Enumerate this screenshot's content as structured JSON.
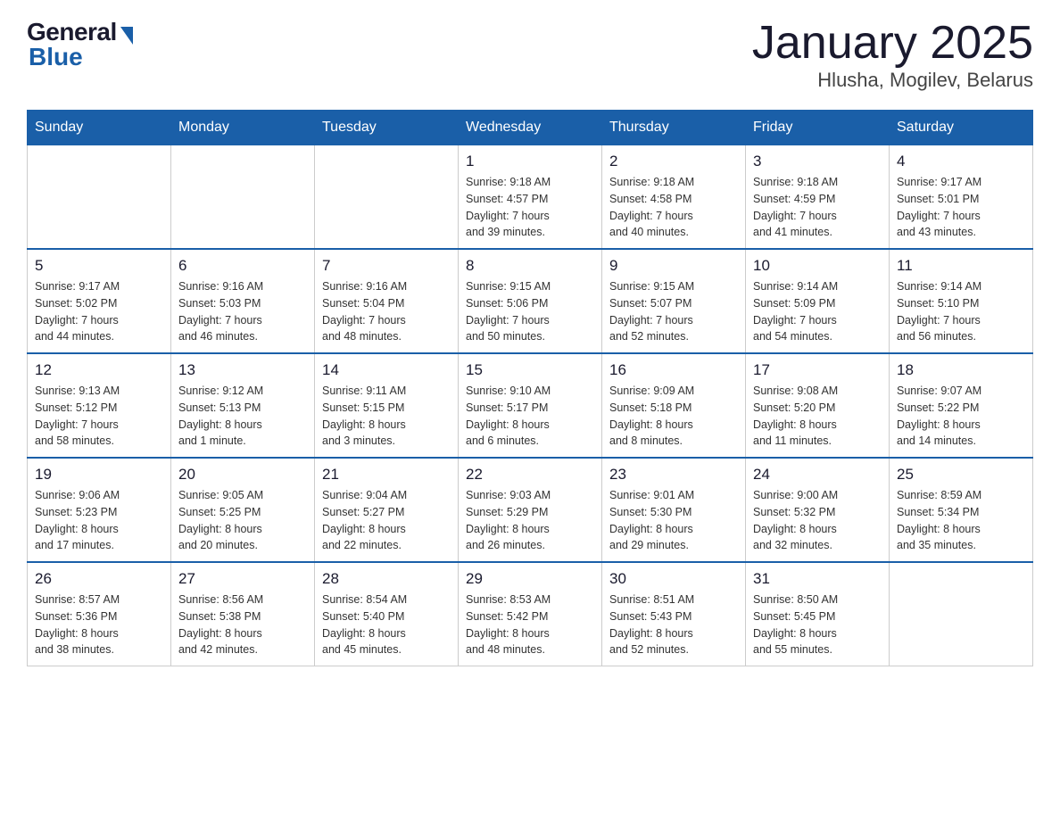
{
  "logo": {
    "general": "General",
    "blue": "Blue"
  },
  "title": "January 2025",
  "subtitle": "Hlusha, Mogilev, Belarus",
  "weekdays": [
    "Sunday",
    "Monday",
    "Tuesday",
    "Wednesday",
    "Thursday",
    "Friday",
    "Saturday"
  ],
  "weeks": [
    [
      {
        "day": "",
        "info": ""
      },
      {
        "day": "",
        "info": ""
      },
      {
        "day": "",
        "info": ""
      },
      {
        "day": "1",
        "info": "Sunrise: 9:18 AM\nSunset: 4:57 PM\nDaylight: 7 hours\nand 39 minutes."
      },
      {
        "day": "2",
        "info": "Sunrise: 9:18 AM\nSunset: 4:58 PM\nDaylight: 7 hours\nand 40 minutes."
      },
      {
        "day": "3",
        "info": "Sunrise: 9:18 AM\nSunset: 4:59 PM\nDaylight: 7 hours\nand 41 minutes."
      },
      {
        "day": "4",
        "info": "Sunrise: 9:17 AM\nSunset: 5:01 PM\nDaylight: 7 hours\nand 43 minutes."
      }
    ],
    [
      {
        "day": "5",
        "info": "Sunrise: 9:17 AM\nSunset: 5:02 PM\nDaylight: 7 hours\nand 44 minutes."
      },
      {
        "day": "6",
        "info": "Sunrise: 9:16 AM\nSunset: 5:03 PM\nDaylight: 7 hours\nand 46 minutes."
      },
      {
        "day": "7",
        "info": "Sunrise: 9:16 AM\nSunset: 5:04 PM\nDaylight: 7 hours\nand 48 minutes."
      },
      {
        "day": "8",
        "info": "Sunrise: 9:15 AM\nSunset: 5:06 PM\nDaylight: 7 hours\nand 50 minutes."
      },
      {
        "day": "9",
        "info": "Sunrise: 9:15 AM\nSunset: 5:07 PM\nDaylight: 7 hours\nand 52 minutes."
      },
      {
        "day": "10",
        "info": "Sunrise: 9:14 AM\nSunset: 5:09 PM\nDaylight: 7 hours\nand 54 minutes."
      },
      {
        "day": "11",
        "info": "Sunrise: 9:14 AM\nSunset: 5:10 PM\nDaylight: 7 hours\nand 56 minutes."
      }
    ],
    [
      {
        "day": "12",
        "info": "Sunrise: 9:13 AM\nSunset: 5:12 PM\nDaylight: 7 hours\nand 58 minutes."
      },
      {
        "day": "13",
        "info": "Sunrise: 9:12 AM\nSunset: 5:13 PM\nDaylight: 8 hours\nand 1 minute."
      },
      {
        "day": "14",
        "info": "Sunrise: 9:11 AM\nSunset: 5:15 PM\nDaylight: 8 hours\nand 3 minutes."
      },
      {
        "day": "15",
        "info": "Sunrise: 9:10 AM\nSunset: 5:17 PM\nDaylight: 8 hours\nand 6 minutes."
      },
      {
        "day": "16",
        "info": "Sunrise: 9:09 AM\nSunset: 5:18 PM\nDaylight: 8 hours\nand 8 minutes."
      },
      {
        "day": "17",
        "info": "Sunrise: 9:08 AM\nSunset: 5:20 PM\nDaylight: 8 hours\nand 11 minutes."
      },
      {
        "day": "18",
        "info": "Sunrise: 9:07 AM\nSunset: 5:22 PM\nDaylight: 8 hours\nand 14 minutes."
      }
    ],
    [
      {
        "day": "19",
        "info": "Sunrise: 9:06 AM\nSunset: 5:23 PM\nDaylight: 8 hours\nand 17 minutes."
      },
      {
        "day": "20",
        "info": "Sunrise: 9:05 AM\nSunset: 5:25 PM\nDaylight: 8 hours\nand 20 minutes."
      },
      {
        "day": "21",
        "info": "Sunrise: 9:04 AM\nSunset: 5:27 PM\nDaylight: 8 hours\nand 22 minutes."
      },
      {
        "day": "22",
        "info": "Sunrise: 9:03 AM\nSunset: 5:29 PM\nDaylight: 8 hours\nand 26 minutes."
      },
      {
        "day": "23",
        "info": "Sunrise: 9:01 AM\nSunset: 5:30 PM\nDaylight: 8 hours\nand 29 minutes."
      },
      {
        "day": "24",
        "info": "Sunrise: 9:00 AM\nSunset: 5:32 PM\nDaylight: 8 hours\nand 32 minutes."
      },
      {
        "day": "25",
        "info": "Sunrise: 8:59 AM\nSunset: 5:34 PM\nDaylight: 8 hours\nand 35 minutes."
      }
    ],
    [
      {
        "day": "26",
        "info": "Sunrise: 8:57 AM\nSunset: 5:36 PM\nDaylight: 8 hours\nand 38 minutes."
      },
      {
        "day": "27",
        "info": "Sunrise: 8:56 AM\nSunset: 5:38 PM\nDaylight: 8 hours\nand 42 minutes."
      },
      {
        "day": "28",
        "info": "Sunrise: 8:54 AM\nSunset: 5:40 PM\nDaylight: 8 hours\nand 45 minutes."
      },
      {
        "day": "29",
        "info": "Sunrise: 8:53 AM\nSunset: 5:42 PM\nDaylight: 8 hours\nand 48 minutes."
      },
      {
        "day": "30",
        "info": "Sunrise: 8:51 AM\nSunset: 5:43 PM\nDaylight: 8 hours\nand 52 minutes."
      },
      {
        "day": "31",
        "info": "Sunrise: 8:50 AM\nSunset: 5:45 PM\nDaylight: 8 hours\nand 55 minutes."
      },
      {
        "day": "",
        "info": ""
      }
    ]
  ]
}
